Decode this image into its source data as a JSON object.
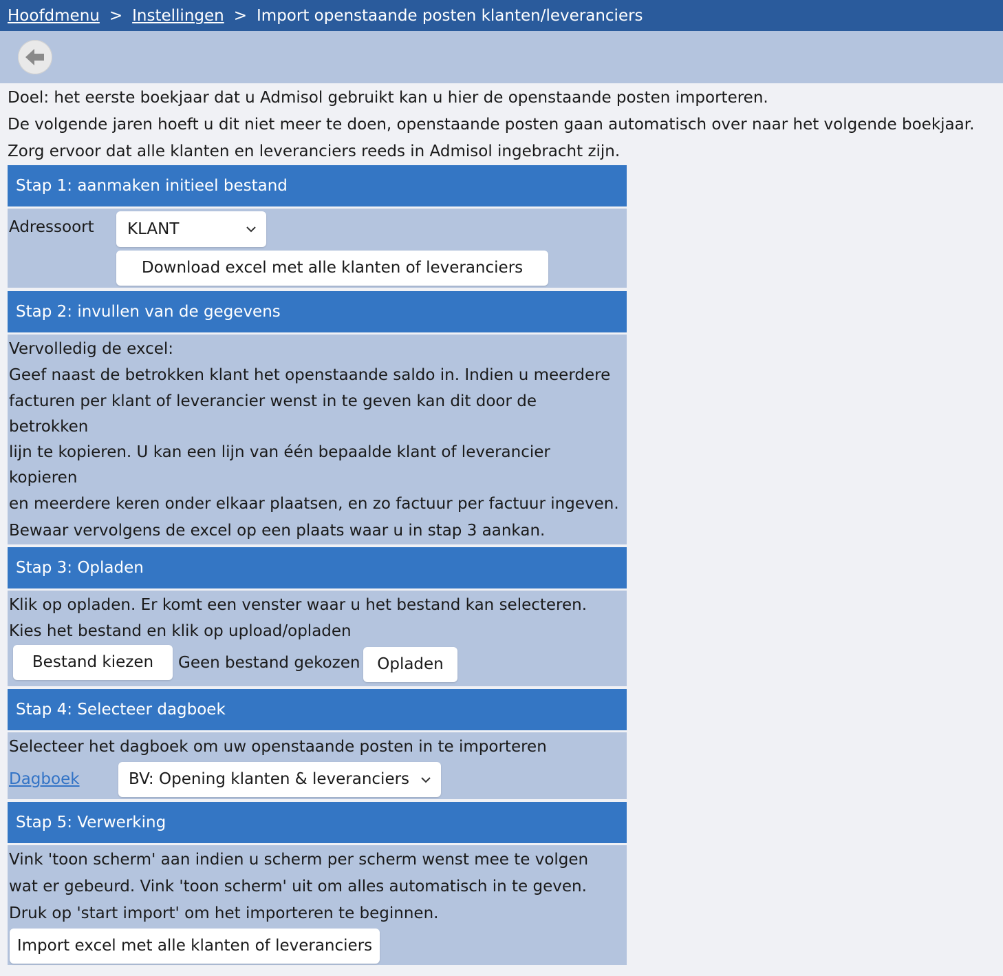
{
  "breadcrumb": {
    "items": [
      "Hoofdmenu",
      "Instellingen"
    ],
    "separator": ">",
    "current": "Import openstaande posten klanten/leveranciers"
  },
  "toolbar": {
    "back_icon": "arrow-left-icon"
  },
  "intro": [
    "Doel: het eerste boekjaar dat u Admisol gebruikt kan u hier de openstaande posten importeren.",
    "De volgende jaren hoeft u dit niet meer te doen, openstaande posten gaan automatisch over naar het volgende boekjaar.",
    "Zorg ervoor dat alle klanten en leveranciers reeds in Admisol ingebracht zijn."
  ],
  "steps": {
    "step1": {
      "title": "Stap 1: aanmaken initieel bestand",
      "adressoort_label": "Adressoort",
      "adressoort_value": "KLANT",
      "download_button": "Download excel met alle klanten of leveranciers"
    },
    "step2": {
      "title": "Stap 2: invullen van de gegevens",
      "lines": [
        "Vervolledig de excel:",
        "Geef naast de betrokken klant het openstaande saldo in. Indien u meerdere",
        "facturen per klant of leverancier wenst in te geven kan dit door de",
        "betrokken",
        "lijn te kopieren. U kan een lijn van één bepaalde klant of leverancier",
        "kopieren",
        "en meerdere keren onder elkaar plaatsen, en zo factuur per factuur ingeven.",
        "Bewaar vervolgens de excel op een plaats waar u in stap 3 aankan."
      ]
    },
    "step3": {
      "title": "Stap 3: Opladen",
      "lines": [
        "Klik op opladen. Er komt een venster waar u het bestand kan selecteren.",
        "Kies het bestand en klik op upload/opladen"
      ],
      "choose_file_button": "Bestand kiezen",
      "no_file_text": "Geen bestand gekozen",
      "upload_button": "Opladen"
    },
    "step4": {
      "title": "Stap 4: Selecteer dagboek",
      "description": "Selecteer het dagboek om uw openstaande posten in te importeren",
      "dagboek_label": "Dagboek",
      "dagboek_value": "BV: Opening klanten & leveranciers"
    },
    "step5": {
      "title": "Stap 5: Verwerking",
      "lines": [
        "Vink 'toon scherm' aan indien u scherm per scherm wenst mee te volgen",
        "wat er gebeurd. Vink 'toon scherm' uit om alles automatisch in te geven.",
        "Druk op 'start import' om het importeren te beginnen."
      ],
      "import_button": "Import excel met alle klanten of leveranciers"
    }
  }
}
